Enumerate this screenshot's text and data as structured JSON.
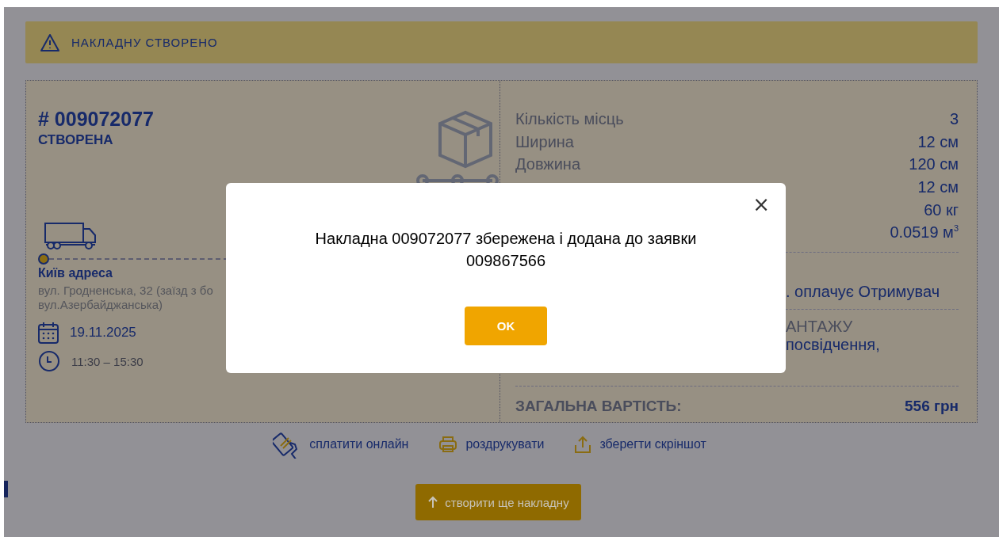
{
  "banner": {
    "text": "НАКЛАДНУ СТВОРЕНО"
  },
  "waybill": {
    "number": "# 009072077",
    "status": "СТВОРЕНА",
    "city": "Київ адреса",
    "address": [
      "вул. Гродненська, 32 (заїзд з бо",
      "вул.Азербайджанська)"
    ],
    "date": "19.11.2025",
    "time": "11:30 – 15:30"
  },
  "details": {
    "rows": [
      {
        "label": "Кількість місць",
        "value": "3"
      },
      {
        "label": "Ширина",
        "value": "12 см"
      },
      {
        "label": "Довжина",
        "value": "120 см"
      },
      {
        "value": "12 см"
      },
      {
        "value": "60 кг"
      },
      {
        "value": "0.0519 м$^{3}$"
      }
    ],
    "payer_fragment": ". оплачує Отримувач",
    "cargo_fragment": "АНТАЖУ",
    "document_fragment": "посвідчення,",
    "total_label": "ЗАГАЛЬНА ВАРТІСТЬ:",
    "total_value": "556 грн"
  },
  "actions": [
    {
      "kind": "pay",
      "label": "сплатити онлайн"
    },
    {
      "kind": "print",
      "label": "роздрукувати"
    },
    {
      "kind": "share",
      "label": "зберегти скріншот"
    }
  ],
  "create_button": "створити ще накладну",
  "dialog": {
    "message": "Накладна 009072077 збережена і додана до заявки 009867566",
    "button": "OK",
    "close": "×"
  }
}
